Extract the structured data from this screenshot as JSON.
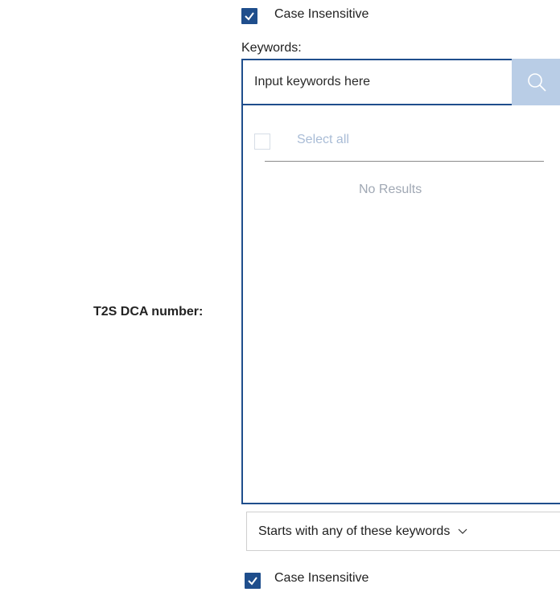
{
  "filter": {
    "case_insensitive_top": {
      "label": "Case Insensitive",
      "checked": true
    },
    "keywords_label": "Keywords:",
    "search": {
      "placeholder": "Input keywords here",
      "value": "",
      "icon": "search-icon"
    },
    "results": {
      "select_all_label": "Select all",
      "empty_text": "No Results"
    },
    "field_label": "T2S DCA number:",
    "match_mode": {
      "selected": "Starts with any of these keywords",
      "icon": "chevron-down-icon"
    },
    "case_insensitive_bottom": {
      "label": "Case Insensitive",
      "checked": true
    }
  },
  "colors": {
    "accent": "#1f4e8c",
    "search_button_bg": "#b9cde6",
    "muted_text": "#a9bcd6"
  }
}
